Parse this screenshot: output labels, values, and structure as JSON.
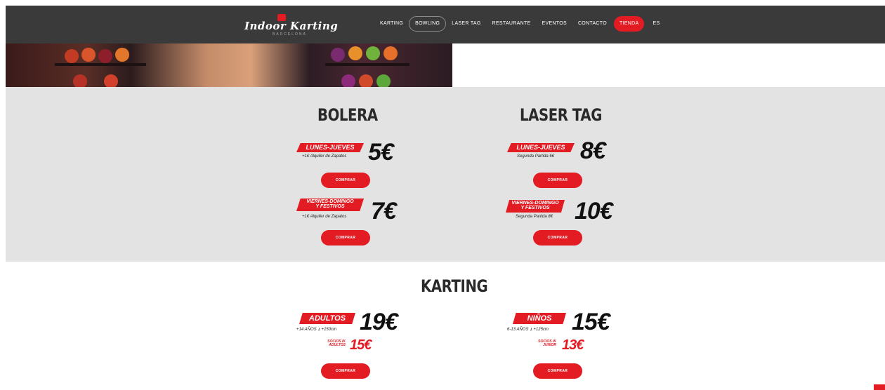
{
  "header": {
    "logo_text": "Indoor Karting",
    "logo_sub": "BARCELONA",
    "nav": [
      "KARTING",
      "BOWLING",
      "LASER TAG",
      "RESTAURANTE",
      "EVENTOS",
      "CONTACTO"
    ],
    "shop_label": "TIENDA",
    "lang": "ES",
    "active_item": "BOWLING"
  },
  "bolera": {
    "title": "BOLERA",
    "weekday": {
      "tag": "LUNES-JUEVES",
      "note": "+1€ Alquiler de Zapatos",
      "price": "5€",
      "button": "COMPRAR"
    },
    "weekend": {
      "tag_line1": "VIERNES-DOMINGO",
      "tag_line2": "Y FESTIVOS",
      "note": "+1€ Alquiler de Zapatos",
      "price": "7€",
      "button": "COMPRAR"
    }
  },
  "laser": {
    "title": "LASER TAG",
    "weekday": {
      "tag": "LUNES-JUEVES",
      "note": "Segunda Partida 6€",
      "price": "8€",
      "button": "COMPRAR"
    },
    "weekend": {
      "tag_line1": "VIERNES-DOMINGO",
      "tag_line2": "Y FESTIVOS",
      "note": "Segunda Partida 8€",
      "price": "10€",
      "button": "COMPRAR"
    }
  },
  "karting": {
    "title": "KARTING",
    "adults": {
      "tag": "ADULTOS",
      "note": "+14 AÑOS  ⍋ +150cm",
      "price": "19€",
      "socios_line1": "SOCIOS IK",
      "socios_line2": "ADULTOS",
      "socios_price": "15€",
      "button": "COMPRAR"
    },
    "kids": {
      "tag": "NIÑOS",
      "note": "6-13 AÑOS  ⍋ +125cm",
      "price": "15€",
      "socios_line1": "SOCIOS IK",
      "socios_line2": "JUNIOR",
      "socios_price": "13€",
      "button": "COMPRAR"
    }
  },
  "colors": {
    "accent": "#e31b23",
    "header_bg": "#3a3a3a",
    "band_bg": "#e3e3e3"
  }
}
